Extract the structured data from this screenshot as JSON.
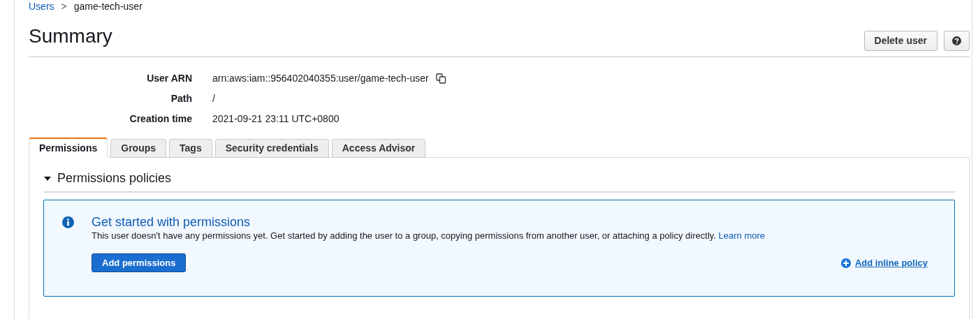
{
  "breadcrumb": [
    {
      "label": "Users",
      "link": true
    },
    {
      "label": "game-tech-user",
      "link": false
    }
  ],
  "breadcrumb_separator": ">",
  "title": "Summary",
  "header_buttons": [
    {
      "kind": "text",
      "label": "Delete user"
    },
    {
      "kind": "help"
    }
  ],
  "details": [
    {
      "label": "User ARN",
      "value": "arn:aws:iam::956402040355:user/game-tech-user",
      "copyable": true
    },
    {
      "label": "Path",
      "value": "/"
    },
    {
      "label": "Creation time",
      "value": "2021-09-21 23:11 UTC+0800"
    }
  ],
  "tabs": [
    {
      "label": "Permissions",
      "selected": true
    },
    {
      "label": "Groups",
      "selected": false
    },
    {
      "label": "Tags",
      "selected": false
    },
    {
      "label": "Security credentials",
      "selected": false
    },
    {
      "label": "Access Advisor",
      "selected": false
    }
  ],
  "section": {
    "title": "Permissions policies",
    "expanded": true
  },
  "info_box": {
    "title": "Get started with permissions",
    "message": "This user doesn't have any permissions yet. Get started by adding the user to a group, copying permissions from another user, or attaching a policy directly.",
    "link": "Learn more",
    "primary_button": "Add permissions",
    "secondary_link": "Add inline policy"
  }
}
